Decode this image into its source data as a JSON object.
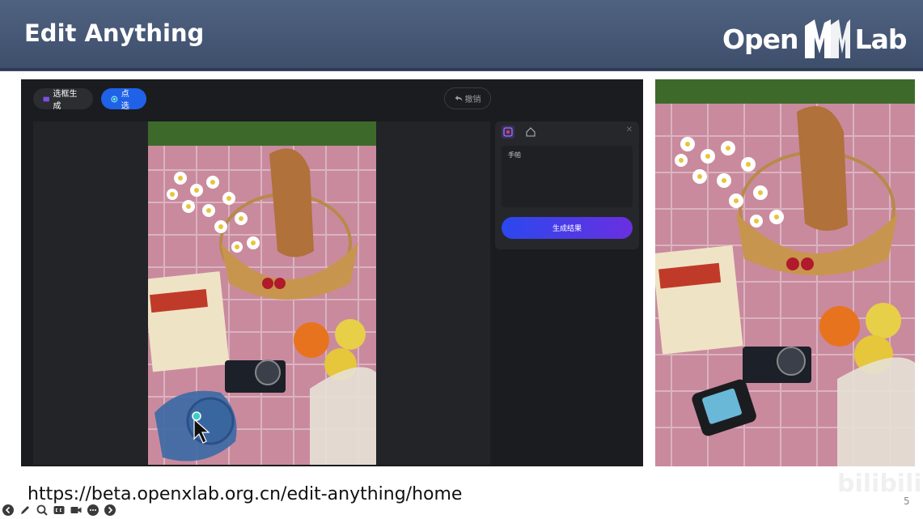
{
  "header": {
    "title": "Edit Anything",
    "logo_left": "Open",
    "logo_right": "Lab"
  },
  "app": {
    "mode_box_label": "选框生成",
    "mode_point_label": "点选",
    "undo_label": "撤销",
    "prompt_text": "手帕",
    "generate_label": "生成结果"
  },
  "footer": {
    "url": "https://beta.openxlab.org.cn/edit-anything/home",
    "page_number": "5",
    "watermark": "bilibili"
  },
  "icons": {
    "toolbar": [
      "back-icon",
      "pen-icon",
      "zoom-icon",
      "captions-icon",
      "video-icon",
      "more-icon",
      "forward-icon"
    ]
  },
  "colors": {
    "header": "#44566f",
    "accent_blue": "#1f62e8",
    "gen_start": "#2b48ee",
    "gen_end": "#6a2fe0",
    "point_marker": "#36d0c8"
  }
}
